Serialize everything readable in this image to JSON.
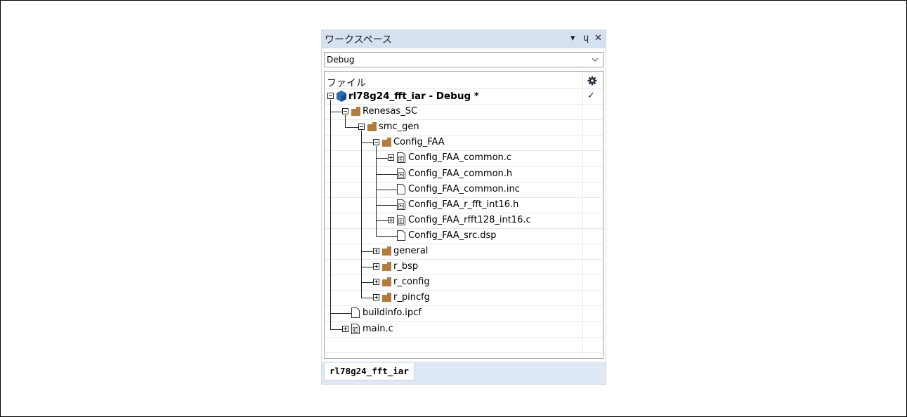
{
  "panel": {
    "title": "ワークスペース",
    "controls": {
      "dropdown": "▾",
      "pin": "ɥ",
      "close": "✕"
    }
  },
  "config_select": {
    "value": "Debug"
  },
  "tree": {
    "header_label": "ファイル",
    "check_mark": "✓",
    "items": [
      {
        "label": "rl78g24_fft_iar - Debug *",
        "icon": "project-icon"
      },
      {
        "label": "Renesas_SC",
        "icon": "folder-icon"
      },
      {
        "label": "smc_gen",
        "icon": "folder-icon"
      },
      {
        "label": "Config_FAA",
        "icon": "folder-icon"
      },
      {
        "label": "Config_FAA_common.c",
        "icon": "c-file-icon"
      },
      {
        "label": "Config_FAA_common.h",
        "icon": "h-file-icon"
      },
      {
        "label": "Config_FAA_common.inc",
        "icon": "file-icon"
      },
      {
        "label": "Config_FAA_r_fft_int16.h",
        "icon": "h-file-icon"
      },
      {
        "label": "Config_FAA_rfft128_int16.c",
        "icon": "c-file-icon"
      },
      {
        "label": "Config_FAA_src.dsp",
        "icon": "file-icon"
      },
      {
        "label": "general",
        "icon": "folder-icon"
      },
      {
        "label": "r_bsp",
        "icon": "folder-icon"
      },
      {
        "label": "r_config",
        "icon": "folder-icon"
      },
      {
        "label": "r_pincfg",
        "icon": "folder-icon"
      },
      {
        "label": "buildinfo.ipcf",
        "icon": "file-icon"
      },
      {
        "label": "main.c",
        "icon": "c-file-icon"
      }
    ]
  },
  "tabs": [
    {
      "label": "rl78g24_fft_iar"
    }
  ],
  "colors": {
    "title_bar": "#d5e0f0",
    "tab_strip": "#dfe8f5",
    "folder": "#b27c3e",
    "project": "#2a6fb0"
  }
}
